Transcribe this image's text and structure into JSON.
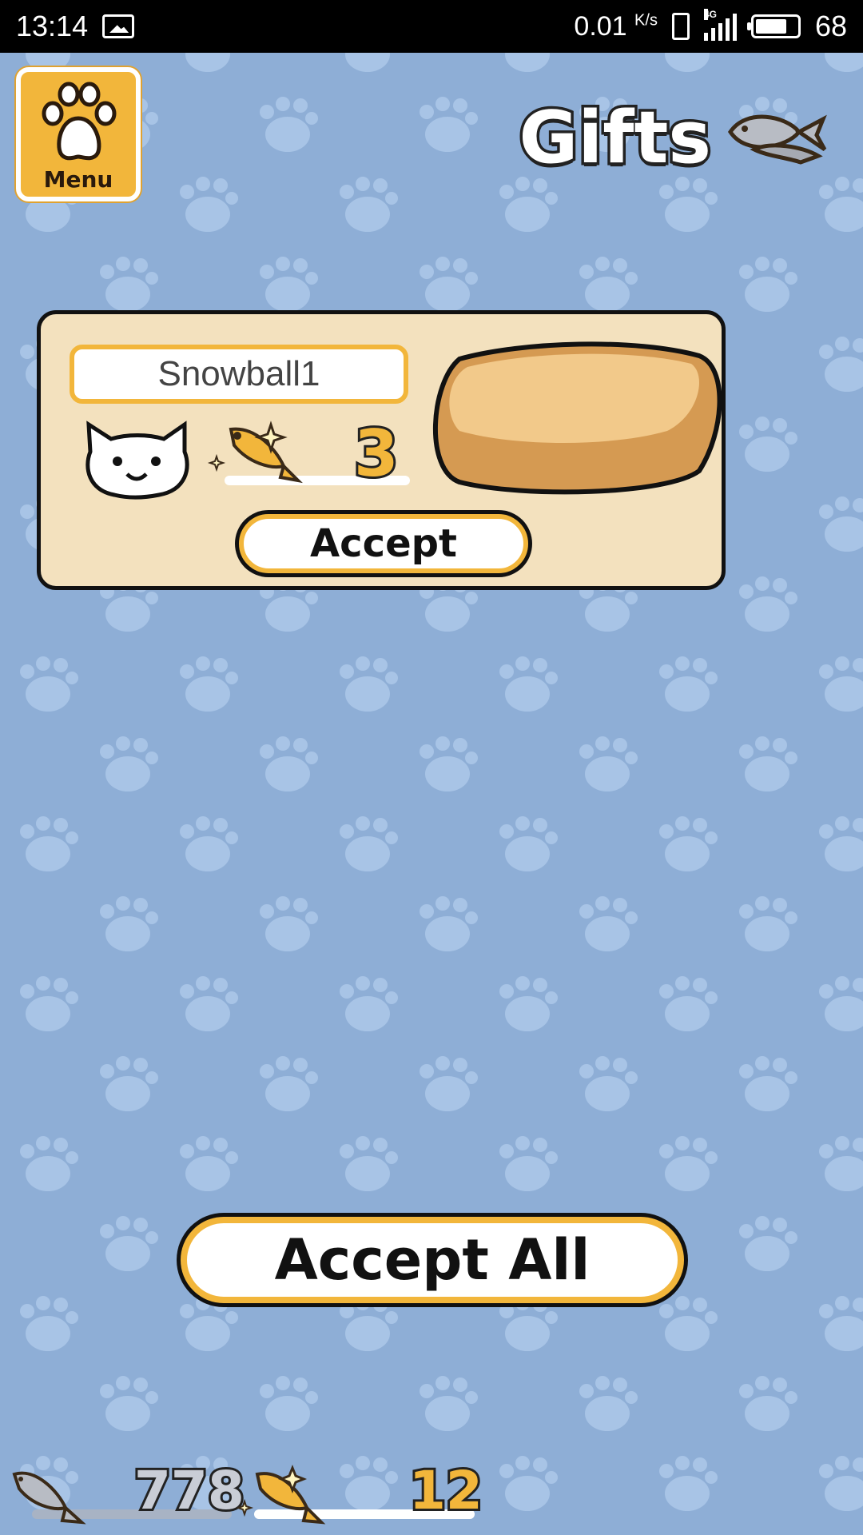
{
  "status_bar": {
    "time": "13:14",
    "net_speed": "0.01",
    "net_unit": "K/s",
    "network_type": "4G",
    "battery": "68"
  },
  "menu": {
    "label": "Menu"
  },
  "header": {
    "title": "Gifts"
  },
  "gift": {
    "cat_name": "Snowball1",
    "count": "3",
    "accept_label": "Accept"
  },
  "accept_all_label": "Accept All",
  "currency": {
    "silver_fish": "778",
    "gold_fish": "12"
  },
  "colors": {
    "background": "#8eaed6",
    "paw_pattern": "#a8c4e6",
    "accent_gold": "#f2b63b",
    "card": "#f3e1be"
  }
}
